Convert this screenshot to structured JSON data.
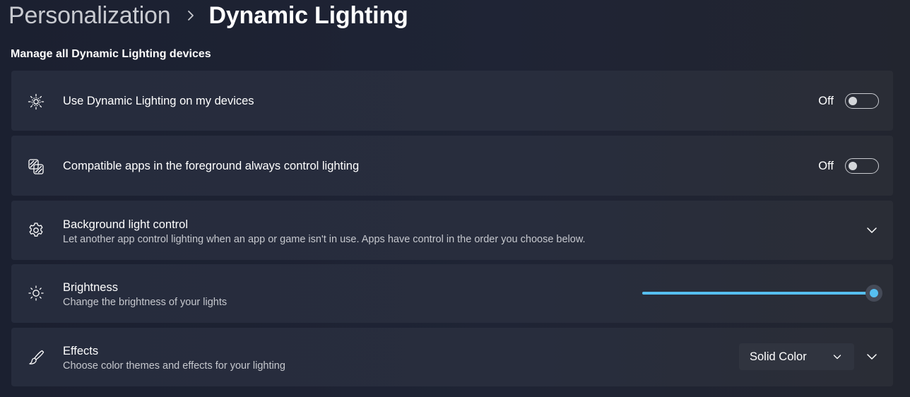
{
  "breadcrumb": {
    "parent": "Personalization",
    "current": "Dynamic Lighting"
  },
  "section": {
    "title": "Manage all Dynamic Lighting devices"
  },
  "settings": {
    "use_dynamic_lighting": {
      "icon": "dynamic-lighting-icon",
      "title": "Use Dynamic Lighting on my devices",
      "state_label": "Off",
      "enabled": false
    },
    "foreground_apps": {
      "icon": "foreground-apps-icon",
      "title": "Compatible apps in the foreground always control lighting",
      "state_label": "Off",
      "enabled": false
    },
    "background_light_control": {
      "icon": "gear-icon",
      "title": "Background light control",
      "subtitle": "Let another app control lighting when an app or game isn't in use. Apps have control in the order you choose below.",
      "expand_icon": "chevron-down-icon"
    },
    "brightness": {
      "icon": "brightness-icon",
      "title": "Brightness",
      "subtitle": "Change the brightness of your lights",
      "value": 1.0
    },
    "effects": {
      "icon": "brush-icon",
      "title": "Effects",
      "subtitle": "Choose color themes and effects for your lighting",
      "selected": "Solid Color",
      "expand_icon": "chevron-down-icon"
    }
  },
  "colors": {
    "accent": "#56bff0",
    "background": "#1f2435",
    "card": "#282d3d"
  }
}
